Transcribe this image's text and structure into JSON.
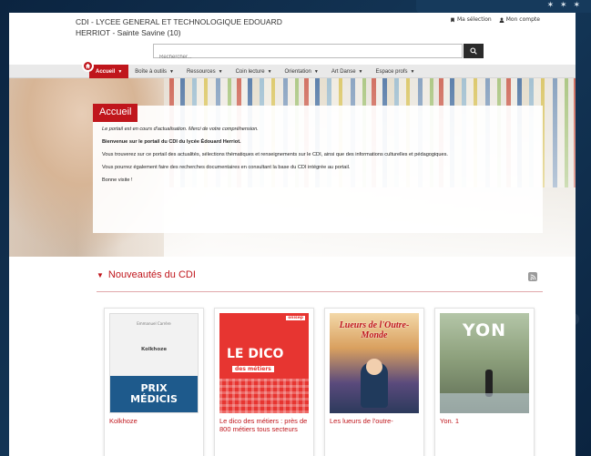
{
  "header": {
    "title_line1": "CDI - LYCEE GENERAL ET TECHNOLOGIQUE EDOUARD",
    "title_line2": "HERRIOT - Sainte Savine (10)",
    "links": [
      {
        "label": "Ma sélection",
        "icon": "bookmark-icon"
      },
      {
        "label": "Mon compte",
        "icon": "user-icon"
      }
    ]
  },
  "search": {
    "placeholder": "Rechercher..."
  },
  "nav": {
    "items": [
      {
        "label": "Accueil",
        "active": true
      },
      {
        "label": "Boîte à outils"
      },
      {
        "label": "Ressources"
      },
      {
        "label": "Coin lecture"
      },
      {
        "label": "Orientation"
      },
      {
        "label": "Art Danse"
      },
      {
        "label": "Espace profs"
      }
    ]
  },
  "hero": {
    "title": "Accueil",
    "p1": "Le portail est en cours d'actualisation. Merci de votre compréhension.",
    "p2": "Bienvenue sur le portail du CDI du lycée Édouard Herriot.",
    "p3": "Vous trouverez sur ce portail des actualités, sélections thématiques et renseignements sur le CDI, ainsi que des informations culturelles et pédagogiques.",
    "p4": "Vous pourrez également faire des recherches documentaires en consultant la base du CDI intégrée au portail.",
    "p5": "Bonne visite !"
  },
  "news": {
    "title": "Nouveautés du CDI",
    "cards": [
      {
        "title": "Kolkhoze",
        "cover_author": "Emmanuel Carrère",
        "cover_title": "Kolkhoze",
        "cover_prize1": "PRIX",
        "cover_prize2": "MÉDICIS"
      },
      {
        "title": "Le dico des métiers : près de 800 métiers tous secteurs",
        "cover_tag": "onisep",
        "cover_big": "LE DICO",
        "cover_sub": "des métiers"
      },
      {
        "title": "Les lueurs de l'outre-",
        "cover_title": "Lueurs de l'Outre-Monde"
      },
      {
        "title": "Yon. 1",
        "cover_title": "YON"
      }
    ]
  },
  "colors": {
    "accent": "#c0161c",
    "nav_bg": "#e9e9e9"
  }
}
